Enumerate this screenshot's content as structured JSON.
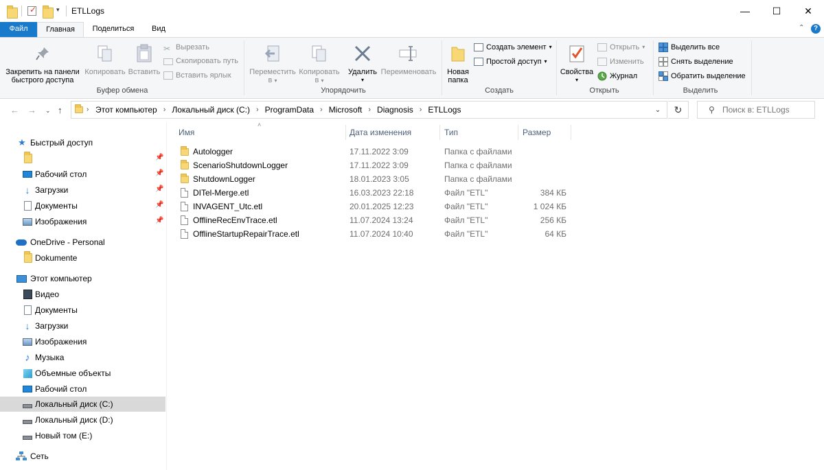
{
  "window": {
    "title": "ETLLogs",
    "minimize": "—",
    "maximize": "☐",
    "close": "✕"
  },
  "tabs": {
    "file": "Файл",
    "home": "Главная",
    "share": "Поделиться",
    "view": "Вид"
  },
  "ribbon": {
    "clipboard": {
      "group": "Буфер обмена",
      "pin": "Закрепить на панели быстрого доступа",
      "pin_line1": "Закрепить на панели",
      "pin_line2": "быстрого доступа",
      "copy": "Копировать",
      "paste": "Вставить",
      "cut": "Вырезать",
      "copy_path": "Скопировать путь",
      "paste_shortcut": "Вставить ярлык"
    },
    "organize": {
      "group": "Упорядочить",
      "move_line1": "Переместить",
      "move_line2": "в",
      "copy_line1": "Копировать",
      "copy_line2": "в",
      "delete": "Удалить",
      "rename": "Переименовать"
    },
    "new": {
      "group": "Создать",
      "new_folder_line1": "Новая",
      "new_folder_line2": "папка",
      "new_item": "Создать элемент",
      "easy_access": "Простой доступ"
    },
    "open": {
      "group": "Открыть",
      "properties": "Свойства",
      "open": "Открыть",
      "edit": "Изменить",
      "history": "Журнал"
    },
    "select": {
      "group": "Выделить",
      "select_all": "Выделить все",
      "select_none": "Снять выделение",
      "invert": "Обратить выделение"
    }
  },
  "address": {
    "crumbs": [
      "Этот компьютер",
      "Локальный диск (C:)",
      "ProgramData",
      "Microsoft",
      "Diagnosis",
      "ETLLogs"
    ],
    "search_placeholder": "Поиск в: ETLLogs"
  },
  "nav": {
    "quick_access": "Быстрый доступ",
    "qa_items": [
      "",
      "Рабочий стол",
      "Загрузки",
      "Документы",
      "Изображения"
    ],
    "onedrive": "OneDrive - Personal",
    "onedrive_items": [
      "Dokumente"
    ],
    "this_pc": "Этот компьютер",
    "pc_items": [
      "Видео",
      "Документы",
      "Загрузки",
      "Изображения",
      "Музыка",
      "Объемные объекты",
      "Рабочий стол",
      "Локальный диск (C:)",
      "Локальный диск (D:)",
      "Новый том (E:)"
    ],
    "network": "Сеть"
  },
  "columns": {
    "name": "Имя",
    "date": "Дата изменения",
    "type": "Тип",
    "size": "Размер"
  },
  "files": [
    {
      "name": "Autologger",
      "date": "17.11.2022 3:09",
      "type": "Папка с файлами",
      "size": "",
      "kind": "folder"
    },
    {
      "name": "ScenarioShutdownLogger",
      "date": "17.11.2022 3:09",
      "type": "Папка с файлами",
      "size": "",
      "kind": "folder"
    },
    {
      "name": "ShutdownLogger",
      "date": "18.01.2023 3:05",
      "type": "Папка с файлами",
      "size": "",
      "kind": "folder"
    },
    {
      "name": "DITel-Merge.etl",
      "date": "16.03.2023 22:18",
      "type": "Файл \"ETL\"",
      "size": "384 КБ",
      "kind": "file"
    },
    {
      "name": "INVAGENT_Utc.etl",
      "date": "20.01.2025 12:23",
      "type": "Файл \"ETL\"",
      "size": "1 024 КБ",
      "kind": "file"
    },
    {
      "name": "OfflineRecEnvTrace.etl",
      "date": "11.07.2024 13:24",
      "type": "Файл \"ETL\"",
      "size": "256 КБ",
      "kind": "file"
    },
    {
      "name": "OfflineStartupRepairTrace.etl",
      "date": "11.07.2024 10:40",
      "type": "Файл \"ETL\"",
      "size": "64 КБ",
      "kind": "file"
    }
  ],
  "colors": {
    "accent": "#1979ca",
    "folder": "#f8d775",
    "header_text": "#4c607a",
    "selected_nav": "#d9d9d9"
  }
}
